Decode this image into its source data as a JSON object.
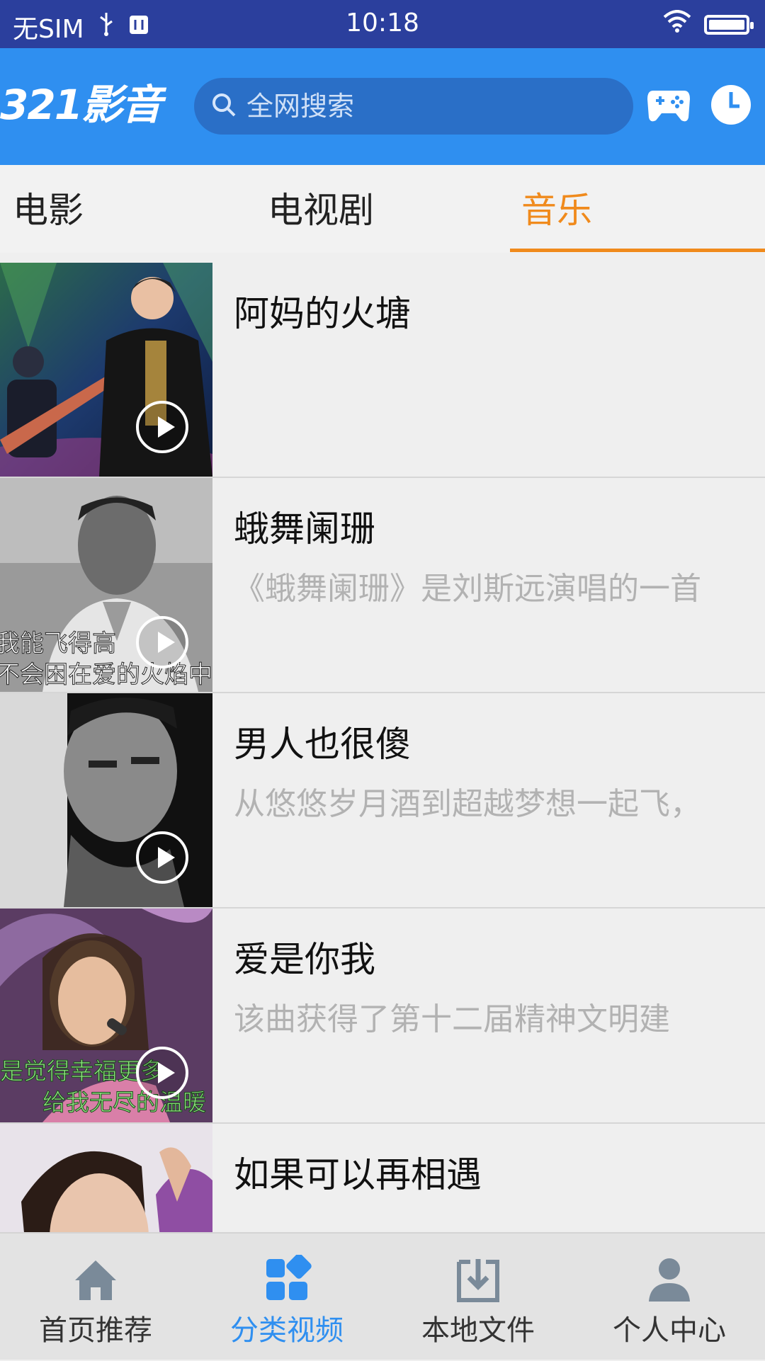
{
  "status_bar": {
    "carrier": "无SIM",
    "time": "10:18"
  },
  "header": {
    "logo": "321影音",
    "search_placeholder": "全网搜索"
  },
  "tabs": [
    {
      "label": "电影",
      "active": false
    },
    {
      "label": "电视剧",
      "active": false
    },
    {
      "label": "音乐",
      "active": true
    }
  ],
  "list": [
    {
      "title": "阿妈的火塘",
      "desc": ""
    },
    {
      "title": "蛾舞阑珊",
      "desc": "《蛾舞阑珊》是刘斯远演唱的一首"
    },
    {
      "title": "男人也很傻",
      "desc": "从悠悠岁月酒到超越梦想一起飞，"
    },
    {
      "title": "爱是你我",
      "desc": "该曲获得了第十二届精神文明建"
    },
    {
      "title": "如果可以再相遇",
      "desc": ""
    }
  ],
  "thumb_captions": {
    "item2": [
      "我能飞得高",
      "不会困在爱的火焰中"
    ],
    "item4": [
      "是觉得幸福更多",
      "给我无尽的温暖"
    ]
  },
  "bottom_nav": [
    {
      "label": "首页推荐",
      "icon": "home-icon",
      "active": false
    },
    {
      "label": "分类视频",
      "icon": "category-icon",
      "active": true
    },
    {
      "label": "本地文件",
      "icon": "download-icon",
      "active": false
    },
    {
      "label": "个人中心",
      "icon": "user-icon",
      "active": false
    }
  ],
  "colors": {
    "status_bar": "#2b3f9d",
    "header": "#2f8ff0",
    "accent": "#f08a1c",
    "nav_active": "#2f8ff0"
  }
}
